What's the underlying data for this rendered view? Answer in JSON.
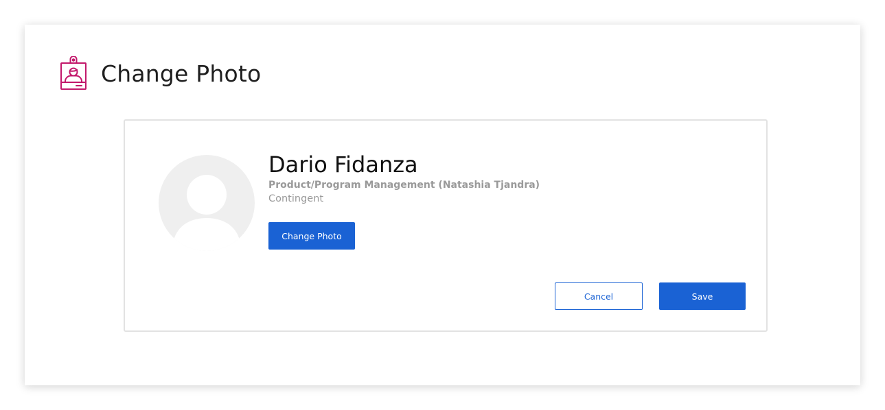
{
  "header": {
    "icon": "id-badge-icon",
    "icon_color": "#c2186b",
    "title": "Change Photo"
  },
  "profile": {
    "avatar": "default-avatar-placeholder",
    "name": "Dario Fidanza",
    "department": "Product/Program Management (Natashia Tjandra)",
    "worker_type": "Contingent"
  },
  "actions": {
    "change_photo_label": "Change Photo",
    "cancel_label": "Cancel",
    "save_label": "Save"
  },
  "colors": {
    "accent": "#1a62d4",
    "muted_text": "#9a9a9a",
    "avatar_bg": "#efefef"
  }
}
